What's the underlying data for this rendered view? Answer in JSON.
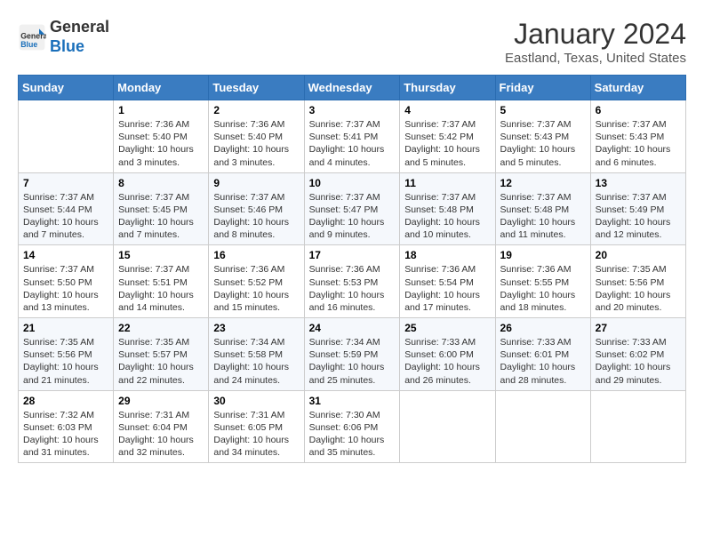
{
  "header": {
    "logo_line1": "General",
    "logo_line2": "Blue",
    "month": "January 2024",
    "location": "Eastland, Texas, United States"
  },
  "weekdays": [
    "Sunday",
    "Monday",
    "Tuesday",
    "Wednesday",
    "Thursday",
    "Friday",
    "Saturday"
  ],
  "weeks": [
    [
      {
        "day": "",
        "empty": true
      },
      {
        "day": "1",
        "sunrise": "7:36 AM",
        "sunset": "5:40 PM",
        "daylight": "10 hours and 3 minutes."
      },
      {
        "day": "2",
        "sunrise": "7:36 AM",
        "sunset": "5:40 PM",
        "daylight": "10 hours and 3 minutes."
      },
      {
        "day": "3",
        "sunrise": "7:37 AM",
        "sunset": "5:41 PM",
        "daylight": "10 hours and 4 minutes."
      },
      {
        "day": "4",
        "sunrise": "7:37 AM",
        "sunset": "5:42 PM",
        "daylight": "10 hours and 5 minutes."
      },
      {
        "day": "5",
        "sunrise": "7:37 AM",
        "sunset": "5:43 PM",
        "daylight": "10 hours and 5 minutes."
      },
      {
        "day": "6",
        "sunrise": "7:37 AM",
        "sunset": "5:43 PM",
        "daylight": "10 hours and 6 minutes."
      }
    ],
    [
      {
        "day": "7",
        "sunrise": "7:37 AM",
        "sunset": "5:44 PM",
        "daylight": "10 hours and 7 minutes."
      },
      {
        "day": "8",
        "sunrise": "7:37 AM",
        "sunset": "5:45 PM",
        "daylight": "10 hours and 7 minutes."
      },
      {
        "day": "9",
        "sunrise": "7:37 AM",
        "sunset": "5:46 PM",
        "daylight": "10 hours and 8 minutes."
      },
      {
        "day": "10",
        "sunrise": "7:37 AM",
        "sunset": "5:47 PM",
        "daylight": "10 hours and 9 minutes."
      },
      {
        "day": "11",
        "sunrise": "7:37 AM",
        "sunset": "5:48 PM",
        "daylight": "10 hours and 10 minutes."
      },
      {
        "day": "12",
        "sunrise": "7:37 AM",
        "sunset": "5:48 PM",
        "daylight": "10 hours and 11 minutes."
      },
      {
        "day": "13",
        "sunrise": "7:37 AM",
        "sunset": "5:49 PM",
        "daylight": "10 hours and 12 minutes."
      }
    ],
    [
      {
        "day": "14",
        "sunrise": "7:37 AM",
        "sunset": "5:50 PM",
        "daylight": "10 hours and 13 minutes."
      },
      {
        "day": "15",
        "sunrise": "7:37 AM",
        "sunset": "5:51 PM",
        "daylight": "10 hours and 14 minutes."
      },
      {
        "day": "16",
        "sunrise": "7:36 AM",
        "sunset": "5:52 PM",
        "daylight": "10 hours and 15 minutes."
      },
      {
        "day": "17",
        "sunrise": "7:36 AM",
        "sunset": "5:53 PM",
        "daylight": "10 hours and 16 minutes."
      },
      {
        "day": "18",
        "sunrise": "7:36 AM",
        "sunset": "5:54 PM",
        "daylight": "10 hours and 17 minutes."
      },
      {
        "day": "19",
        "sunrise": "7:36 AM",
        "sunset": "5:55 PM",
        "daylight": "10 hours and 18 minutes."
      },
      {
        "day": "20",
        "sunrise": "7:35 AM",
        "sunset": "5:56 PM",
        "daylight": "10 hours and 20 minutes."
      }
    ],
    [
      {
        "day": "21",
        "sunrise": "7:35 AM",
        "sunset": "5:56 PM",
        "daylight": "10 hours and 21 minutes."
      },
      {
        "day": "22",
        "sunrise": "7:35 AM",
        "sunset": "5:57 PM",
        "daylight": "10 hours and 22 minutes."
      },
      {
        "day": "23",
        "sunrise": "7:34 AM",
        "sunset": "5:58 PM",
        "daylight": "10 hours and 24 minutes."
      },
      {
        "day": "24",
        "sunrise": "7:34 AM",
        "sunset": "5:59 PM",
        "daylight": "10 hours and 25 minutes."
      },
      {
        "day": "25",
        "sunrise": "7:33 AM",
        "sunset": "6:00 PM",
        "daylight": "10 hours and 26 minutes."
      },
      {
        "day": "26",
        "sunrise": "7:33 AM",
        "sunset": "6:01 PM",
        "daylight": "10 hours and 28 minutes."
      },
      {
        "day": "27",
        "sunrise": "7:33 AM",
        "sunset": "6:02 PM",
        "daylight": "10 hours and 29 minutes."
      }
    ],
    [
      {
        "day": "28",
        "sunrise": "7:32 AM",
        "sunset": "6:03 PM",
        "daylight": "10 hours and 31 minutes."
      },
      {
        "day": "29",
        "sunrise": "7:31 AM",
        "sunset": "6:04 PM",
        "daylight": "10 hours and 32 minutes."
      },
      {
        "day": "30",
        "sunrise": "7:31 AM",
        "sunset": "6:05 PM",
        "daylight": "10 hours and 34 minutes."
      },
      {
        "day": "31",
        "sunrise": "7:30 AM",
        "sunset": "6:06 PM",
        "daylight": "10 hours and 35 minutes."
      },
      {
        "day": "",
        "empty": true
      },
      {
        "day": "",
        "empty": true
      },
      {
        "day": "",
        "empty": true
      }
    ]
  ]
}
